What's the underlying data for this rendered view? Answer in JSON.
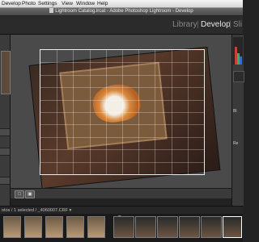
{
  "menubar": {
    "items": [
      "Develop",
      "Photo",
      "Settings",
      "View",
      "Window",
      "Help"
    ]
  },
  "window": {
    "title": "Lightroom Catalog.lrcat - Adobe Photoshop Lightroom - Develop"
  },
  "modules": {
    "library": "Library",
    "sep1": "|",
    "develop": "Develop",
    "sep2": "|",
    "slideshow": "Sli"
  },
  "right_panel": {
    "label1": "Bl",
    "label2": "Re"
  },
  "toolbar": {
    "btn1": "□",
    "btn2": "▣"
  },
  "filmstrip": {
    "path": "otos / 1 selected / _4060007.CRF ▾"
  }
}
